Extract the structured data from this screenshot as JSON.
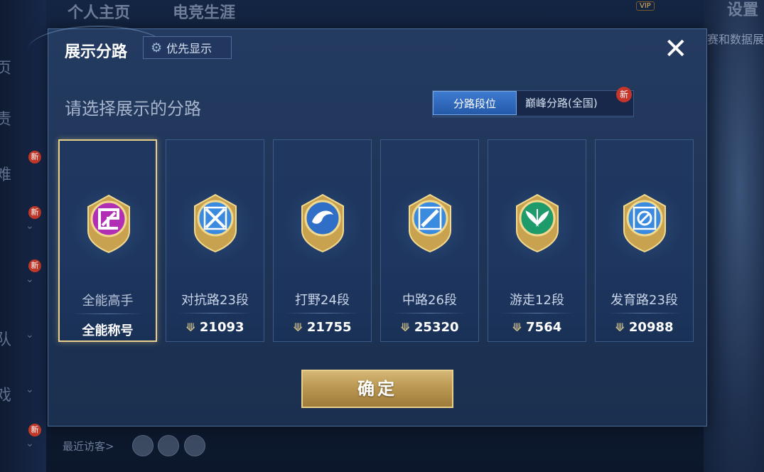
{
  "background": {
    "tabs": [
      "个人主页",
      "电竞生涯"
    ],
    "settings_label": "设置",
    "stats_label": "赛和数据展",
    "vip_label": "VIP",
    "recent_visitors_label": "最近访客>"
  },
  "modal": {
    "title": "展示分路",
    "priority_button": "优先显示",
    "subtitle": "请选择展示的分路",
    "tabs": [
      {
        "label": "分路段位",
        "active": true
      },
      {
        "label": "巅峰分路(全国)",
        "active": false,
        "badge": "新"
      }
    ],
    "cards": [
      {
        "name": "全能高手",
        "value": "全能称号",
        "selected": true,
        "color": "#b12fb5",
        "icon": "all-round-icon"
      },
      {
        "name": "对抗路23段",
        "value": "21093",
        "selected": false,
        "color": "#3a8be0",
        "icon": "clash-lane-icon"
      },
      {
        "name": "打野24段",
        "value": "21755",
        "selected": false,
        "color": "#2f6fc8",
        "icon": "jungle-dragon-icon"
      },
      {
        "name": "中路26段",
        "value": "25320",
        "selected": false,
        "color": "#3a8be0",
        "icon": "mid-lane-icon"
      },
      {
        "name": "游走12段",
        "value": "7564",
        "selected": false,
        "color": "#1f9a6a",
        "icon": "roam-icon"
      },
      {
        "name": "发育路23段",
        "value": "20988",
        "selected": false,
        "color": "#3a8be0",
        "icon": "farm-lane-icon"
      }
    ],
    "confirm_button": "确定"
  }
}
